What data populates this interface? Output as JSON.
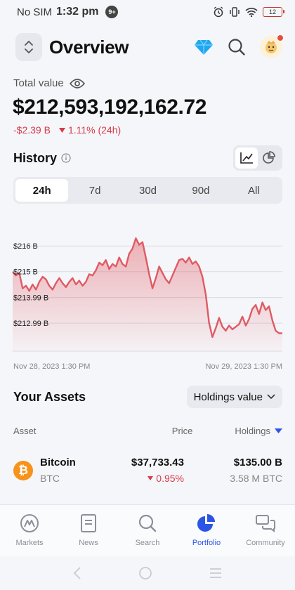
{
  "status_bar": {
    "carrier": "No SIM",
    "time": "1:32 pm",
    "notif_count": "9+",
    "battery": "12"
  },
  "header": {
    "title": "Overview"
  },
  "portfolio": {
    "total_label": "Total value",
    "total_value": "$212,593,192,162.72",
    "change_abs": "-$2.39 B",
    "change_pct": "1.11% (24h)"
  },
  "history": {
    "title": "History",
    "tabs": [
      "24h",
      "7d",
      "30d",
      "90d",
      "All"
    ],
    "active_tab": "24h"
  },
  "chart_data": {
    "type": "area",
    "title": "",
    "xlabel": "",
    "ylabel": "",
    "yticks": [
      "$216 B",
      "$215 B",
      "$213.99 B",
      "$212.99 B"
    ],
    "y_tick_values": [
      216.0,
      215.0,
      213.99,
      212.99
    ],
    "x_start_label": "Nov 28, 2023 1:30 PM",
    "x_end_label": "Nov 29, 2023 1:30 PM",
    "ylim": [
      211.9,
      217.1
    ],
    "grid": true,
    "color": "#e05a64",
    "series": [
      {
        "values": [
          215.0,
          214.85,
          214.95,
          214.35,
          214.45,
          214.25,
          214.5,
          214.3,
          214.6,
          214.8,
          214.7,
          214.45,
          214.3,
          214.55,
          214.75,
          214.55,
          214.4,
          214.6,
          214.75,
          214.5,
          214.65,
          214.45,
          214.6,
          214.9,
          214.85,
          215.05,
          215.35,
          215.25,
          215.45,
          215.1,
          215.3,
          215.2,
          215.55,
          215.3,
          215.2,
          215.7,
          215.9,
          216.3,
          216.05,
          216.15,
          215.55,
          214.9,
          214.35,
          214.75,
          215.2,
          214.95,
          214.7,
          214.55,
          214.85,
          215.15,
          215.45,
          215.5,
          215.35,
          215.55,
          215.3,
          215.4,
          215.2,
          214.8,
          214.1,
          213.0,
          212.45,
          212.8,
          213.2,
          212.85,
          212.7,
          212.9,
          212.75,
          212.85,
          212.95,
          213.25,
          212.9,
          213.15,
          213.55,
          213.7,
          213.35,
          213.8,
          213.5,
          213.65,
          213.1,
          212.7,
          212.6,
          212.6
        ]
      }
    ]
  },
  "assets": {
    "title": "Your Assets",
    "sort_select": "Holdings value",
    "columns": {
      "asset": "Asset",
      "price": "Price",
      "holdings": "Holdings"
    },
    "rows": [
      {
        "icon_letter": "₿",
        "name": "Bitcoin",
        "symbol": "BTC",
        "price": "$37,733.43",
        "change": "0.95%",
        "holdings_value": "$135.00 B",
        "holdings_qty": "3.58 M BTC"
      }
    ]
  },
  "bottom_nav": {
    "items": [
      "Markets",
      "News",
      "Search",
      "Portfolio",
      "Community"
    ],
    "active": "Portfolio"
  },
  "colors": {
    "accent": "#2b55e6",
    "negative": "#d63a4a",
    "chart_line": "#e05a64",
    "btc": "#f7931a"
  }
}
